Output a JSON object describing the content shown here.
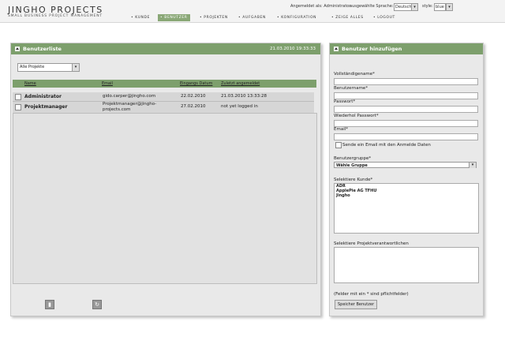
{
  "app": {
    "title": "JINGHO PROJECTS",
    "subtitle": "SMALL BUSINESS PROJECT MANAGEMENT"
  },
  "topbar": {
    "logged_in": "Angemeldet als: Administrator",
    "language_label": "ausgewählte Sprache:",
    "language_value": "Deutsch",
    "style_label": "style:",
    "style_value": "blue"
  },
  "nav": [
    {
      "label": "KUNDE"
    },
    {
      "label": "BENUTZER"
    },
    {
      "label": "PROJEKTEN"
    },
    {
      "label": "AUFGABEN"
    },
    {
      "label": "KONFIGURATION"
    },
    {
      "label": "ZEIGE ALLES"
    },
    {
      "label": "LOGOUT"
    }
  ],
  "userlist": {
    "title": "Benutzerliste",
    "datetime": "21.03.2010 19:33:33",
    "filter_value": "Alle Projekte",
    "columns": [
      "Name",
      "Email",
      "Eingangs Datum",
      "Zuletzt angemeldet"
    ],
    "rows": [
      {
        "name": "Administrator",
        "email": "gido.carper@jingho.com",
        "date": "22.02.2010",
        "last": "21.03.2010 13:33:28"
      },
      {
        "name": "Projektmanager",
        "email": "Projektmanager@jingho-projects.com",
        "date": "27.02.2010",
        "last": "not yet logged in"
      }
    ]
  },
  "addform": {
    "title": "Benutzer hinzufügen",
    "fullname_label": "Vollständigename*",
    "username_label": "Benutzername*",
    "password_label": "Passwort*",
    "password2_label": "Wiederhol Passwort*",
    "email_label": "Email*",
    "send_email_label": "Sende ein Email mit den Anmelde Daten",
    "group_label": "Benutzergruppe*",
    "group_value": "Wähle Gruppe",
    "customers_label": "Selektiere Kunde*",
    "customers": [
      "ADR",
      "ApplePie AG TFHU",
      "Jingho"
    ],
    "pm_label": "Selektiere Projektverantwortlichen",
    "required_note": "(Felder mit ein * sind pflichtfelder)",
    "submit_label": "Speicher Benutzer"
  }
}
